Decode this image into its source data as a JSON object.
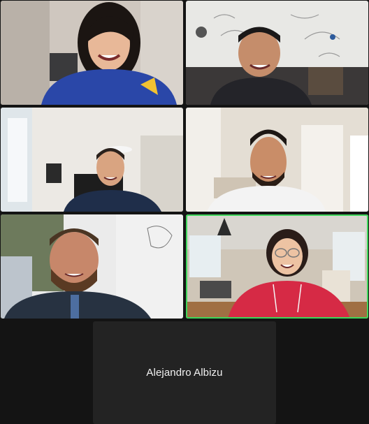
{
  "window": {
    "background": "#141414",
    "active_speaker_color": "#3ed65b"
  },
  "participants": [
    {
      "id": "tile-1",
      "type": "video",
      "active": false,
      "shirt_color": "#2a47a8",
      "room_color": "#cfc9c2"
    },
    {
      "id": "tile-2",
      "type": "video",
      "active": false,
      "shirt_color": "#2b2b34",
      "room_color": "#e7e7e3"
    },
    {
      "id": "tile-3",
      "type": "video",
      "active": false,
      "shirt_color": "#1f2e4a",
      "room_color": "#e6e3de"
    },
    {
      "id": "tile-4",
      "type": "video",
      "active": false,
      "shirt_color": "#f1f1f1",
      "room_color": "#e3ddd3"
    },
    {
      "id": "tile-5",
      "type": "video",
      "active": false,
      "shirt_color": "#273241",
      "room_color": "#eaeaea"
    },
    {
      "id": "tile-6",
      "type": "video",
      "active": true,
      "shirt_color": "#d62a45",
      "room_color": "#d9d6d0"
    },
    {
      "id": "tile-7",
      "type": "camera-off",
      "active": false,
      "name": "Alejandro Albizu"
    }
  ]
}
